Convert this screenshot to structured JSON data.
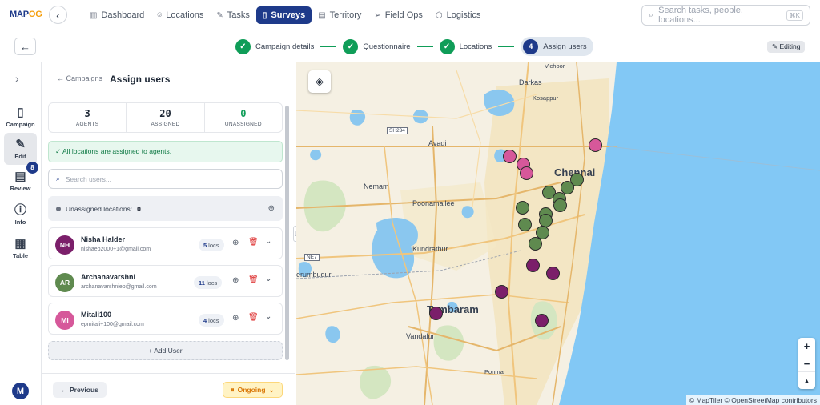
{
  "brand": {
    "logo_text_a": "MAP",
    "logo_text_b": "OG"
  },
  "nav": [
    {
      "label": "Dashboard",
      "icon": "bar-chart-icon",
      "glyph": "▥"
    },
    {
      "label": "Locations",
      "icon": "pin-icon",
      "glyph": "⌾"
    },
    {
      "label": "Tasks",
      "icon": "pen-icon",
      "glyph": "✎"
    },
    {
      "label": "Surveys",
      "icon": "clipboard-icon",
      "glyph": "▯",
      "active": true
    },
    {
      "label": "Territory",
      "icon": "map-icon",
      "glyph": "▤"
    },
    {
      "label": "Field Ops",
      "icon": "send-icon",
      "glyph": "➢"
    },
    {
      "label": "Logistics",
      "icon": "box-icon",
      "glyph": "⬡"
    }
  ],
  "search": {
    "placeholder": "Search tasks, people, locations...",
    "shortcut": "⌘K"
  },
  "steps": [
    {
      "label": "Campaign details",
      "state": "done",
      "mark": "✓"
    },
    {
      "label": "Questionnaire",
      "state": "done",
      "mark": "✓"
    },
    {
      "label": "Locations",
      "state": "done",
      "mark": "✓"
    },
    {
      "label": "Assign users",
      "state": "current",
      "mark": "4"
    }
  ],
  "editing_label": "✎ Editing",
  "rail": [
    {
      "label": "Campaign",
      "icon": "clipboard-icon",
      "glyph": "▯"
    },
    {
      "label": "Edit",
      "icon": "edit-icon",
      "glyph": "✎",
      "active": true
    },
    {
      "label": "Review",
      "icon": "document-icon",
      "glyph": "▤"
    },
    {
      "label": "Info",
      "icon": "info-icon",
      "glyph": "ⓘ"
    },
    {
      "label": "Table",
      "icon": "grid-icon",
      "glyph": "▦"
    }
  ],
  "review_badge": "8",
  "user_avatar": "M",
  "panel": {
    "back_link": "← Campaigns",
    "title": "Assign users",
    "stats": [
      {
        "value": "3",
        "label": "AGENTS"
      },
      {
        "value": "20",
        "label": "ASSIGNED"
      },
      {
        "value": "0",
        "label": "UNASSIGNED"
      }
    ],
    "alert": "✓ All locations are assigned to agents.",
    "user_search_placeholder": "Search users...",
    "unassigned_label": "Unassigned locations:",
    "unassigned_count": "0",
    "users": [
      {
        "initials": "NH",
        "name": "Nisha Halder",
        "email": "nishaep2000+1@gmail.com",
        "locs": "5",
        "color": "#7b1f6a"
      },
      {
        "initials": "AR",
        "name": "Archanavarshni",
        "email": "archanavarshniep@gmail.com",
        "locs": "11",
        "color": "#5f8a4f"
      },
      {
        "initials": "MI",
        "name": "Mitali100",
        "email": "epmitali+100@gmail.com",
        "locs": "4",
        "color": "#d6589a"
      }
    ],
    "locs_suffix": "locs",
    "add_user": "+ Add User"
  },
  "footer": {
    "previous": "← Previous",
    "status": "Ongoing"
  },
  "map": {
    "labels": [
      {
        "text": "Vichoor",
        "cls": "small"
      },
      {
        "text": "Darkas",
        "cls": ""
      },
      {
        "text": "Kosappur",
        "cls": "small"
      },
      {
        "text": "Avadi",
        "cls": ""
      },
      {
        "text": "Chennai",
        "cls": "city"
      },
      {
        "text": "Nemam",
        "cls": ""
      },
      {
        "text": "Poonamallee",
        "cls": ""
      },
      {
        "text": "Kundrathur",
        "cls": ""
      },
      {
        "text": "erumbudur",
        "cls": ""
      },
      {
        "text": "Tambaram",
        "cls": "city"
      },
      {
        "text": "Vandalur",
        "cls": ""
      },
      {
        "text": "Ponmar",
        "cls": "small"
      }
    ],
    "shields": [
      "SH234",
      "NE7"
    ],
    "attribution": "© MapTiler © OpenStreetMap contributors",
    "zoom_in": "+",
    "zoom_out": "−",
    "compass": "▲"
  }
}
